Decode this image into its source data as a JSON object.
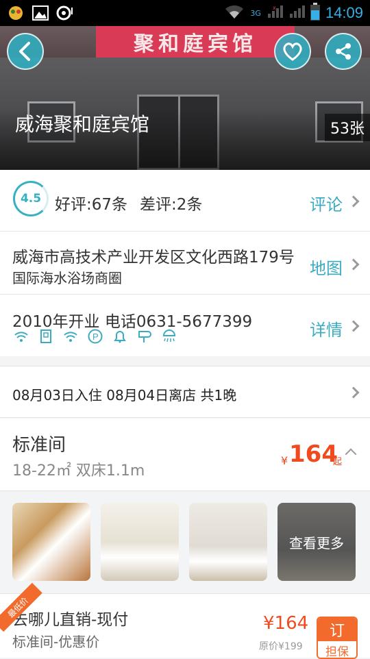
{
  "status_bar": {
    "time": "14:09",
    "network": "3G"
  },
  "hero": {
    "sign_text": "聚和庭宾馆",
    "hotel_name": "威海聚和庭宾馆",
    "photo_count": "53张"
  },
  "rating": {
    "score": "4.5",
    "good": "好评:67条",
    "bad": "差评:2条",
    "link": "评论"
  },
  "address": {
    "line1": "威海市高技术产业开发区文化西路179号",
    "line2": "国际海水浴场商圈",
    "link": "地图"
  },
  "info": {
    "line1": "2010年开业  电话0631-5677399",
    "link": "详情",
    "amenities": [
      "wifi-icon",
      "phone-icon",
      "wifi-icon",
      "parking-icon",
      "bell-icon",
      "hairdryer-icon",
      "shower-icon"
    ]
  },
  "dates": {
    "text": "08月03日入住  08月04日离店  共1晚"
  },
  "room": {
    "name": "标准间",
    "details": "18-22㎡ 双床1.1m",
    "currency": "¥",
    "price": "164",
    "suffix": "起"
  },
  "thumbs": {
    "more_label": "查看更多"
  },
  "offer": {
    "badge": "最低价",
    "title": "去哪儿直销-现付",
    "subtitle": "标准间-优惠价",
    "price": "¥164",
    "orig": "原价¥199",
    "book_label": "订",
    "guarantee_label": "担保"
  },
  "colors": {
    "accent": "#35b2c1",
    "price": "#f04a1f",
    "orange": "#f26b2c"
  }
}
